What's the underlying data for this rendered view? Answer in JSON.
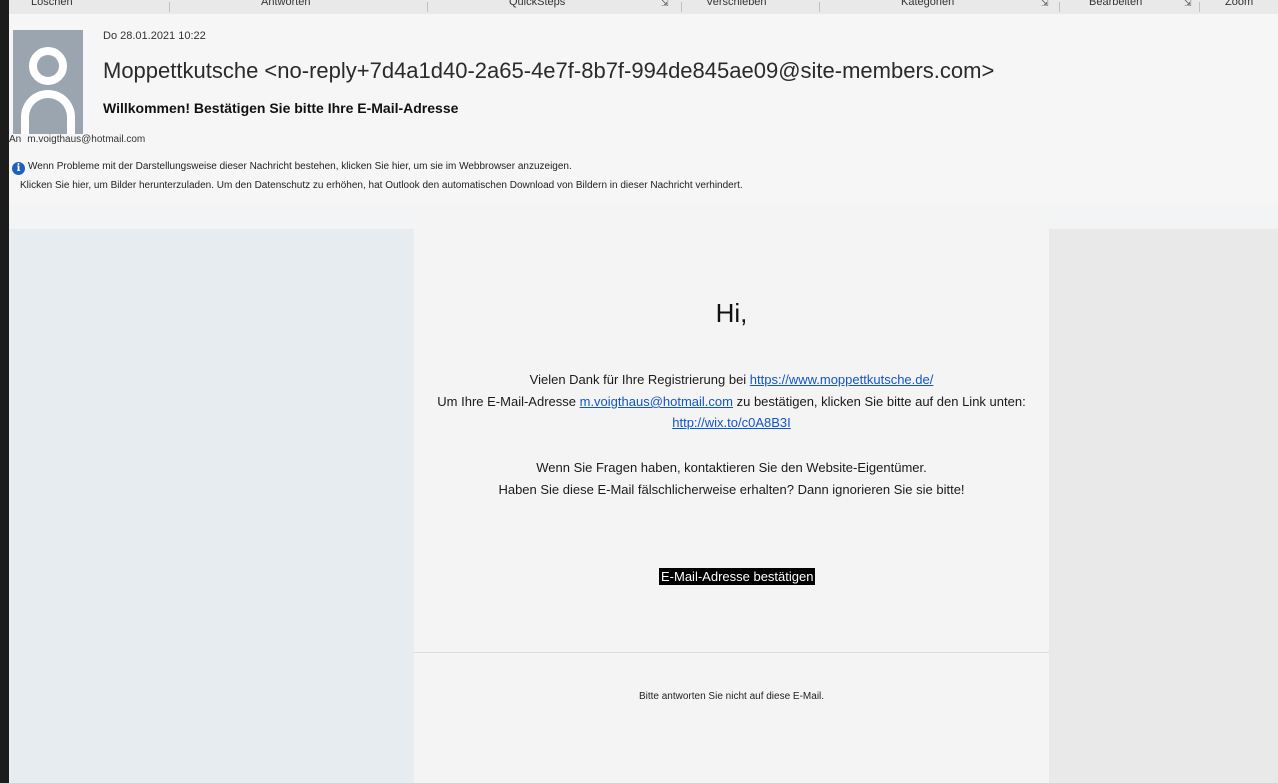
{
  "ribbon": {
    "groups": [
      "Löschen",
      "Antworten",
      "QuickSteps",
      "Verschieben",
      "Kategorien",
      "Bearbeiten",
      "Zoom"
    ]
  },
  "header": {
    "date": "Do 28.01.2021 10:22",
    "sender": "Moppettkutsche <no-reply+7d4a1d40-2a65-4e7f-8b7f-994de845ae09@site-members.com>",
    "subject": "Willkommen! Bestätigen Sie bitte Ihre E-Mail-Adresse",
    "to_label": "An",
    "to_address": "m.voigthaus@hotmail.com",
    "info_line1": "Wenn Probleme mit der Darstellungsweise dieser Nachricht bestehen, klicken Sie hier, um sie im Webbrowser anzuzeigen.",
    "info_line2": "Klicken Sie hier, um Bilder herunterzuladen. Um den Datenschutz zu erhöhen, hat Outlook den automatischen Download von Bildern in dieser Nachricht verhindert."
  },
  "body": {
    "greeting": "Hi,",
    "thanks_text": "Vielen Dank für Ihre Registrierung bei ",
    "site_link": "https://www.moppettkutsche.de/",
    "confirm_pre": "Um Ihre E-Mail-Adresse ",
    "email_link": "m.voigthaus@hotmail.com",
    "confirm_post": " zu bestätigen, klicken Sie bitte auf den Link unten:",
    "confirm_link": "http://wix.to/c0A8B3I",
    "questions": "Wenn Sie Fragen haben, kontaktieren Sie den Website-Eigentümer.",
    "ignore": "Haben Sie diese E-Mail fälschlicherweise erhalten? Dann ignorieren Sie sie bitte!",
    "button_label": "E-Mail-Adresse bestätigen",
    "footer": "Bitte antworten Sie nicht auf diese E-Mail."
  },
  "colors": {
    "link": "#1155cc",
    "info_icon": "#1f5fbf",
    "button_bg": "#000000"
  }
}
